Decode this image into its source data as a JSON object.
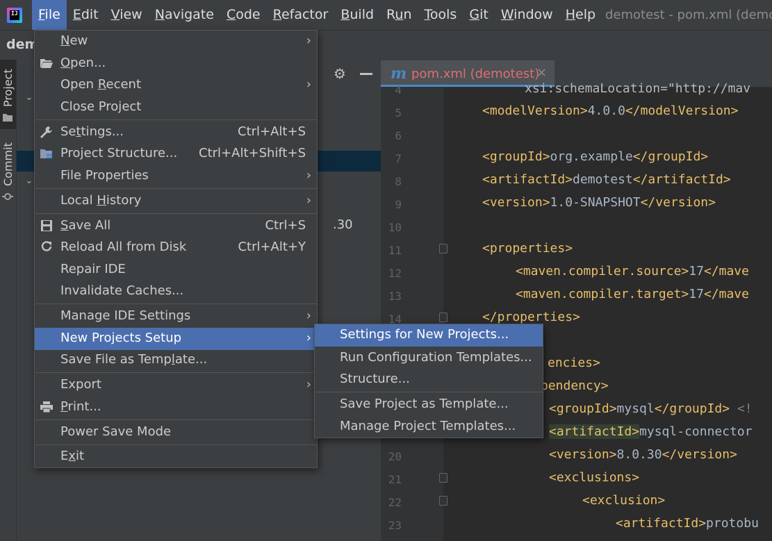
{
  "menubar": {
    "logo_text": "IJ",
    "items": [
      {
        "pre": "",
        "mn": "F",
        "post": "ile",
        "active": true
      },
      {
        "pre": "",
        "mn": "E",
        "post": "dit"
      },
      {
        "pre": "",
        "mn": "V",
        "post": "iew"
      },
      {
        "pre": "",
        "mn": "N",
        "post": "avigate"
      },
      {
        "pre": "",
        "mn": "C",
        "post": "ode"
      },
      {
        "pre": "",
        "mn": "R",
        "post": "efactor"
      },
      {
        "pre": "",
        "mn": "B",
        "post": "uild"
      },
      {
        "pre": "R",
        "mn": "u",
        "post": "n"
      },
      {
        "pre": "",
        "mn": "T",
        "post": "ools"
      },
      {
        "pre": "",
        "mn": "G",
        "post": "it"
      },
      {
        "pre": "",
        "mn": "W",
        "post": "indow"
      },
      {
        "pre": "",
        "mn": "H",
        "post": "elp"
      }
    ],
    "window_title": "demotest - pom.xml (demotest)"
  },
  "nav": {
    "project_crumb": "dem"
  },
  "tool_strip": {
    "project_label": "Project",
    "commit_label": "Commit"
  },
  "project_panel": {
    "fragment": ".30"
  },
  "editor": {
    "tab": {
      "icon": "m",
      "name": "pom.xml (demotest)",
      "close": "×"
    },
    "line_numbers": [
      "4",
      "5",
      "6",
      "7",
      "8",
      "9",
      "10",
      "11",
      "12",
      "13",
      "14",
      "",
      "",
      "",
      "",
      "20",
      "21",
      "22",
      "23"
    ],
    "lines": {
      "l4": "xsi:schemaLocation=\"http://mav",
      "l5a": "<modelVersion>",
      "l5b": "4.0.0",
      "l5c": "</modelVersion>",
      "l7a": "<groupId>",
      "l7b": "org.example",
      "l7c": "</groupId>",
      "l8a": "<artifactId>",
      "l8b": "demotest",
      "l8c": "</artifactId>",
      "l9a": "<version>",
      "l9b": "1.0-SNAPSHOT",
      "l9c": "</version>",
      "l11": "<properties>",
      "l12a": "<maven.compiler.source>",
      "l12b": "17",
      "l12c": "</mave",
      "l13a": "<maven.compiler.target>",
      "l13b": "17",
      "l13c": "</mave",
      "l14": "</properties>",
      "l16": "encies>",
      "l17": "pendency>",
      "l18a": "<groupId>",
      "l18b": "mysql",
      "l18c": "</groupId>",
      "l18d": " <!",
      "l19a": "<artifactId>",
      "l19b": "mysql-connector",
      "l20a": "<version>",
      "l20b": "8.0.30",
      "l20c": "</version>",
      "l21": "<exclusions>",
      "l22": "<exclusion>",
      "l23a": "<artifactId>",
      "l23b": "protobu"
    }
  },
  "file_menu": {
    "items": [
      {
        "pre": "",
        "mn": "N",
        "post": "ew",
        "submenu": true
      },
      {
        "pre": "",
        "mn": "O",
        "post": "pen...",
        "icon": "folder-open-icon"
      },
      {
        "pre": "Open ",
        "mn": "R",
        "post": "ecent",
        "submenu": true
      },
      {
        "pre": "Close Project",
        "mn": "",
        "post": ""
      },
      {
        "pre": "Se",
        "mn": "t",
        "post": "tings...",
        "shortcut": "Ctrl+Alt+S",
        "icon": "wrench-icon"
      },
      {
        "pre": "Project Structure...",
        "mn": "",
        "post": "",
        "shortcut": "Ctrl+Alt+Shift+S",
        "icon": "project-structure-icon"
      },
      {
        "pre": "File Properties",
        "mn": "",
        "post": "",
        "submenu": true
      },
      {
        "pre": "Local ",
        "mn": "H",
        "post": "istory",
        "submenu": true
      },
      {
        "pre": "",
        "mn": "S",
        "post": "ave All",
        "shortcut": "Ctrl+S",
        "icon": "save-icon"
      },
      {
        "pre": "Reload All from Disk",
        "mn": "",
        "post": "",
        "shortcut": "Ctrl+Alt+Y",
        "icon": "reload-icon"
      },
      {
        "pre": "Repair IDE",
        "mn": "",
        "post": ""
      },
      {
        "pre": "Invalidate Caches...",
        "mn": "",
        "post": ""
      },
      {
        "pre": "Manage IDE Settings",
        "mn": "",
        "post": "",
        "submenu": true
      },
      {
        "pre": "New Projects Setup",
        "mn": "",
        "post": "",
        "submenu": true,
        "selected": true
      },
      {
        "pre": "Save File as Temp",
        "mn": "l",
        "post": "ate..."
      },
      {
        "pre": "Export",
        "mn": "",
        "post": "",
        "submenu": true
      },
      {
        "pre": "",
        "mn": "P",
        "post": "rint...",
        "icon": "print-icon"
      },
      {
        "pre": "Power Save Mode",
        "mn": "",
        "post": ""
      },
      {
        "pre": "E",
        "mn": "x",
        "post": "it"
      }
    ]
  },
  "submenu": {
    "items": [
      {
        "label": "Settings for New Projects...",
        "selected": true
      },
      {
        "label": "Run Configuration Templates..."
      },
      {
        "label": "Structure..."
      },
      {
        "label": "Save Project as Template..."
      },
      {
        "label": "Manage Project Templates..."
      }
    ]
  }
}
